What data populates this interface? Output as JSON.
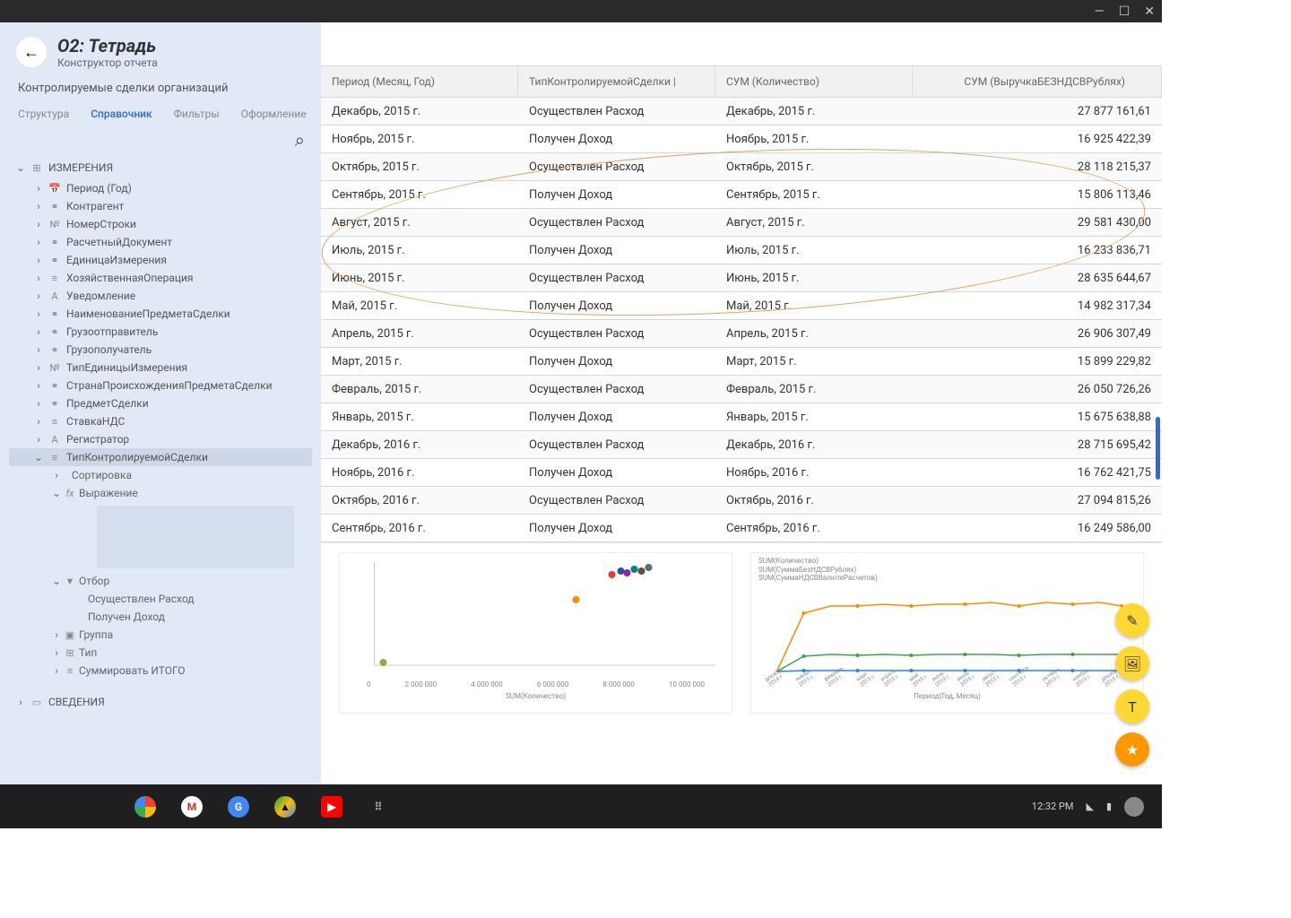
{
  "window": {
    "title": "О2: Тетрадь",
    "subtitle": "Конструктор отчета",
    "desc": "Контролируемые сделки организаций"
  },
  "tabs": {
    "t0": "Структура",
    "t1": "Справочник",
    "t2": "Фильтры",
    "t3": "Оформление"
  },
  "tree": {
    "sec_dim": "ИЗМЕРЕНИЯ",
    "items": [
      {
        "ico": "📅",
        "label": "Период (Год)"
      },
      {
        "ico": "⚭",
        "label": "Контрагент"
      },
      {
        "ico": "№",
        "label": "НомерСтроки"
      },
      {
        "ico": "⚭",
        "label": "РасчетныйДокумент"
      },
      {
        "ico": "⚭",
        "label": "ЕдиницаИзмерения"
      },
      {
        "ico": "≡",
        "label": "ХозяйственнаяОперация"
      },
      {
        "ico": "A",
        "label": "Уведомление"
      },
      {
        "ico": "⚭",
        "label": "НаименованиеПредметаСделки"
      },
      {
        "ico": "⚭",
        "label": "Грузоотправитель"
      },
      {
        "ico": "⚭",
        "label": "Грузополучатель"
      },
      {
        "ico": "№",
        "label": "ТипЕдиницыИзмерения"
      },
      {
        "ico": "⚭",
        "label": "СтранаПроисхожденияПредметаСделки"
      },
      {
        "ico": "⚭",
        "label": "ПредметСделки"
      },
      {
        "ico": "≡",
        "label": "СтавкаНДС"
      },
      {
        "ico": "A",
        "label": "Регистратор"
      },
      {
        "ico": "≡",
        "label": "ТипКонтролируемойСделки"
      }
    ],
    "sub_sort": "Сортировка",
    "sub_expr": "Выражение",
    "sub_filter": "Отбор",
    "filter_v1": "Осуществлен Расход",
    "filter_v2": "Получен Доход",
    "sub_group": "Группа",
    "sub_type": "Тип",
    "sub_sum": "Суммировать ИТОГО",
    "sec_info": "СВЕДЕНИЯ"
  },
  "grid": {
    "h1": "Период (Месяц, Год)",
    "h2": "ТипКонтролируемойСделки |",
    "h3": "СУМ (Количество)",
    "h4": "СУМ (ВыручкаБЕЗНДСВРублях)",
    "rows": [
      {
        "c1": "Декабрь, 2015 г.",
        "c2": "Осуществлен Расход",
        "c3": "Декабрь, 2015 г.",
        "c4": "27 877 161,61"
      },
      {
        "c1": "Ноябрь, 2015 г.",
        "c2": "Получен Доход",
        "c3": "Ноябрь, 2015 г.",
        "c4": "16 925 422,39"
      },
      {
        "c1": "Октябрь, 2015 г.",
        "c2": "Осуществлен Расход",
        "c3": "Октябрь, 2015 г.",
        "c4": "28 118 215,37"
      },
      {
        "c1": "Сентябрь, 2015 г.",
        "c2": "Получен Доход",
        "c3": "Сентябрь, 2015 г.",
        "c4": "15 806 113,46"
      },
      {
        "c1": "Август, 2015 г.",
        "c2": "Осуществлен Расход",
        "c3": "Август, 2015 г.",
        "c4": "29 581 430,00"
      },
      {
        "c1": "Июль, 2015 г.",
        "c2": "Получен Доход",
        "c3": "Июль, 2015 г.",
        "c4": "16 233 836,71"
      },
      {
        "c1": "Июнь, 2015 г.",
        "c2": "Осуществлен Расход",
        "c3": "Июнь, 2015 г.",
        "c4": "28 635 644,67"
      },
      {
        "c1": "Май, 2015 г.",
        "c2": "Получен Доход",
        "c3": "Май, 2015 г.",
        "c4": "14 982 317,34"
      },
      {
        "c1": "Апрель, 2015 г.",
        "c2": "Осуществлен Расход",
        "c3": "Апрель, 2015 г.",
        "c4": "26 906 307,49"
      },
      {
        "c1": "Март, 2015 г.",
        "c2": "Получен Доход",
        "c3": "Март, 2015 г.",
        "c4": "15 899 229,82"
      },
      {
        "c1": "Февраль, 2015 г.",
        "c2": "Осуществлен Расход",
        "c3": "Февраль, 2015 г.",
        "c4": "26 050 726,26"
      },
      {
        "c1": "Январь, 2015 г.",
        "c2": "Получен Доход",
        "c3": "Январь, 2015 г.",
        "c4": "15 675 638,88"
      },
      {
        "c1": "Декабрь, 2016 г.",
        "c2": "Осуществлен Расход",
        "c3": "Декабрь, 2016 г.",
        "c4": "28 715 695,42"
      },
      {
        "c1": "Ноябрь, 2016 г.",
        "c2": "Получен Доход",
        "c3": "Ноябрь, 2016 г.",
        "c4": "16 762 421,75"
      },
      {
        "c1": "Октябрь, 2016 г.",
        "c2": "Осуществлен Расход",
        "c3": "Октябрь, 2016 г.",
        "c4": "27 094 815,26"
      },
      {
        "c1": "Сентябрь, 2016 г.",
        "c2": "Получен Доход",
        "c3": "Сентябрь, 2016 г.",
        "c4": "16 249 586,00"
      }
    ]
  },
  "chart1": {
    "xlabel": "SUM(Количество)",
    "ticks": [
      "0",
      "2 000 000",
      "4 000 000",
      "6 000 000",
      "8 000 000",
      "10 000 000"
    ]
  },
  "chart2": {
    "legend": [
      "SUM(Количество)",
      "SUM(СуммаБезНДСВРублях)",
      "SUM(СуммаНДСВВалютеРасчетов)"
    ],
    "xlabel": "Период(Год, Месяц)",
    "ticks": [
      "декабрь 2014 г.",
      "январь 2015 г.",
      "февраль 2015 г.",
      "март 2015 г.",
      "апрель 2015 г.",
      "май 2015 г.",
      "июнь 2015 г.",
      "июль 2015 г.",
      "август 2015 г.",
      "сентябрь 2015 г.",
      "октябрь 2015 г.",
      "ноябрь 2015 г.",
      "декабрь 2015 г."
    ]
  },
  "taskbar": {
    "time": "12:32 PM"
  }
}
